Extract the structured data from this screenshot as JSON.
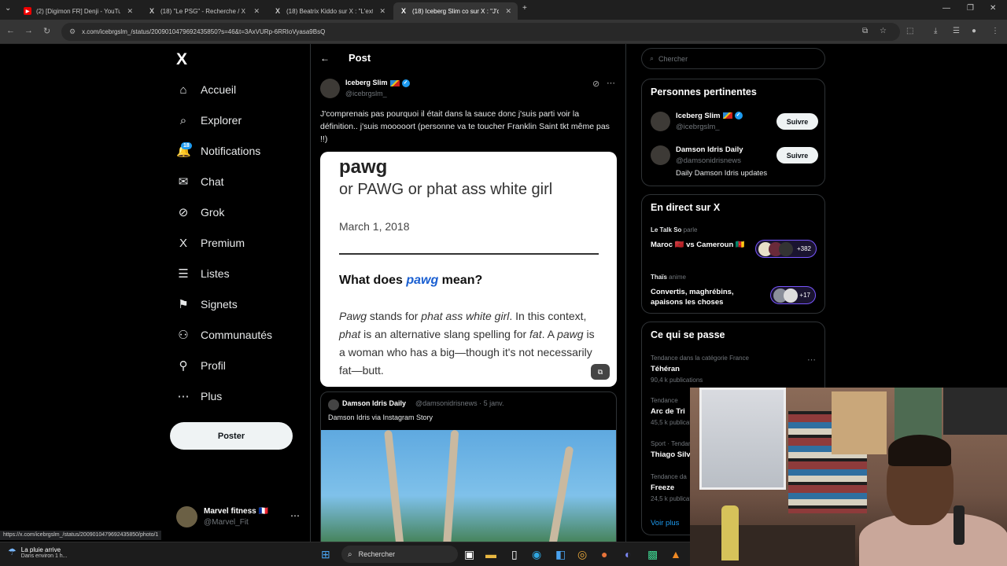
{
  "browser": {
    "tabs": [
      {
        "title": "(2) [Digimon FR] Denji - YouTube",
        "favicon": "youtube"
      },
      {
        "title": "(18) \"Le PSG\" - Recherche / X",
        "favicon": "x"
      },
      {
        "title": "(18) Beatrix Kiddo sur X : \"L'ext",
        "favicon": "x"
      },
      {
        "title": "(18) Iceberg Slim co sur X : \"J'co",
        "favicon": "x",
        "active": true
      }
    ],
    "url": "x.com/icebrgslm_/status/2009010479692435850?s=46&t=3AxVURp-6RRIoVyasa9BsQ"
  },
  "nav": {
    "logo": "X",
    "items": [
      {
        "label": "Accueil",
        "icon": "home-icon",
        "glyph": "⌂"
      },
      {
        "label": "Explorer",
        "icon": "search-icon",
        "glyph": "⌕"
      },
      {
        "label": "Notifications",
        "icon": "bell-icon",
        "glyph": "🔔"
      },
      {
        "label": "Chat",
        "icon": "mail-icon",
        "glyph": "✉"
      },
      {
        "label": "Grok",
        "icon": "grok-icon",
        "glyph": "⊘"
      },
      {
        "label": "Premium",
        "icon": "x-premium-icon",
        "glyph": "X"
      },
      {
        "label": "Listes",
        "icon": "list-icon",
        "glyph": "☰"
      },
      {
        "label": "Signets",
        "icon": "bookmark-icon",
        "glyph": "⚑"
      },
      {
        "label": "Communautés",
        "icon": "communities-icon",
        "glyph": "⚇"
      },
      {
        "label": "Profil",
        "icon": "profile-icon",
        "glyph": "⚲"
      },
      {
        "label": "Plus",
        "icon": "more-circle-icon",
        "glyph": "⋯"
      }
    ],
    "notif_badge": "18",
    "post_button": "Poster",
    "account": {
      "name": "Marvel fitness 🇫🇷",
      "handle": "@Marvel_Fit"
    }
  },
  "status_url": "https://x.com/icebrgslm_/status/2009010479692435850/photo/1",
  "post": {
    "header_title": "Post",
    "author": {
      "name": "Iceberg Slim",
      "handle": "@icebrgslm_"
    },
    "text": "J'comprenais pas pourquoi il était dans la sauce donc j'suis parti voir la définition.. j'suis mooooort (personne va te toucher Franklin Saint tkt même pas !!)",
    "card": {
      "word": "pawg",
      "alt": "or PAWG or phat ass white girl",
      "date": "March 1, 2018",
      "question_prefix": "What does ",
      "question_word": "pawg",
      "question_suffix": " mean?",
      "def_1": "Pawg",
      "def_2": " stands for ",
      "def_3": "phat ass white girl",
      "def_4": ". In this context, ",
      "def_5": "phat",
      "def_6": " is an alternative slang spelling for ",
      "def_7": "fat",
      "def_8": ". A ",
      "def_9": "pawg",
      "def_10": " is a woman who has a big—though it's not necessarily fat—butt."
    },
    "quote": {
      "name": "Damson Idris Daily",
      "meta": "@damsonidrisnews · 5 janv.",
      "text": "Damson Idris via Instagram Story"
    }
  },
  "right": {
    "search_placeholder": "Chercher",
    "relevant_title": "Personnes pertinentes",
    "relevant": [
      {
        "name": "Iceberg Slim",
        "handle": "@icebrgslm_",
        "desc": "",
        "button": "Suivre"
      },
      {
        "name": "Damson Idris Daily",
        "handle": "@damsonidrisnews",
        "desc": "Daily Damson Idris updates",
        "button": "Suivre"
      }
    ],
    "live_title": "En direct sur X",
    "live": [
      {
        "host": "Le Talk So",
        "action": "parle",
        "title": "Maroc 🇲🇦 vs Cameroun 🇨🇲",
        "count": "+382"
      },
      {
        "host": "Thaïs",
        "action": "anime",
        "title": "Convertis, maghrébins, apaisons les choses",
        "count": "+17"
      }
    ],
    "trends_title": "Ce qui se passe",
    "trends": [
      {
        "category": "Tendance dans la catégorie France",
        "name": "Téhéran",
        "count": "90,4 k publications"
      },
      {
        "category": "Tendance",
        "name": "Arc de Tri",
        "count": "45,5 k publications"
      },
      {
        "category": "Sport · Tendance",
        "name": "Thiago Silv",
        "count": ""
      },
      {
        "category": "Tendance da",
        "name": "Freeze",
        "count": "24,5 k publicat"
      }
    ],
    "see_more": "Voir plus"
  },
  "taskbar": {
    "weather_title": "La pluie arrive",
    "weather_sub": "Dans environ 1 h...",
    "search": "Rechercher"
  }
}
